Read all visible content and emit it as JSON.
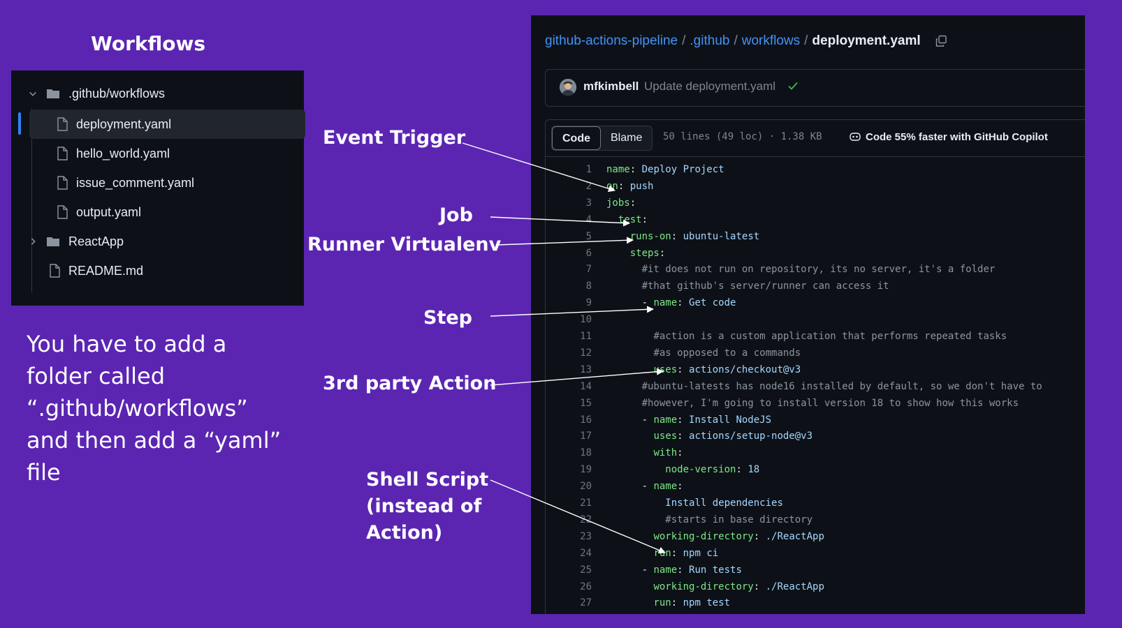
{
  "slide": {
    "title": "Workflows",
    "explanation": "You have to add a folder called “.github/workflows” and then add a “yaml” file"
  },
  "tree": {
    "items": [
      {
        "label": ".github/workflows",
        "kind": "folder",
        "expanded": true
      },
      {
        "label": "deployment.yaml",
        "kind": "file",
        "selected": true
      },
      {
        "label": "hello_world.yaml",
        "kind": "file"
      },
      {
        "label": "issue_comment.yaml",
        "kind": "file"
      },
      {
        "label": "output.yaml",
        "kind": "file"
      },
      {
        "label": "ReactApp",
        "kind": "folder",
        "expanded": false
      },
      {
        "label": "README.md",
        "kind": "file"
      }
    ]
  },
  "annotations": {
    "event_trigger": "Event Trigger",
    "job": "Job",
    "runner": "Runner Virtualenv",
    "step": "Step",
    "third_party": "3rd party Action",
    "shell_l1": "Shell Script",
    "shell_l2": "(instead of",
    "shell_l3": "Action)"
  },
  "viewer": {
    "breadcrumb": {
      "repo": "github-actions-pipeline",
      "sep": "/",
      "dir1": ".github",
      "dir2": "workflows",
      "file": "deployment.yaml"
    },
    "commit": {
      "user": "mfkimbell",
      "message": "Update deployment.yaml"
    },
    "tabs": {
      "code": "Code",
      "blame": "Blame"
    },
    "meta": "50 lines (49 loc) · 1.38 KB",
    "copilot": "Code 55% faster with GitHub Copilot"
  },
  "code_lines": [
    {
      "n": "1",
      "indent": "",
      "key": "name",
      "val": "Deploy Project"
    },
    {
      "n": "2",
      "indent": "",
      "key": "on",
      "val": "push"
    },
    {
      "n": "3",
      "indent": "",
      "key": "jobs",
      "val": ""
    },
    {
      "n": "4",
      "indent": "  ",
      "key": "test",
      "val": ""
    },
    {
      "n": "5",
      "indent": "    ",
      "key": "runs-on",
      "val": "ubuntu-latest"
    },
    {
      "n": "6",
      "indent": "    ",
      "key": "steps",
      "val": ""
    },
    {
      "n": "7",
      "indent": "      ",
      "comment": "#it does not run on repository, its no server, it's a folder"
    },
    {
      "n": "8",
      "indent": "      ",
      "comment": "#that github's server/runner can access it"
    },
    {
      "n": "9",
      "indent": "      ",
      "dash": true,
      "key": "name",
      "val": "Get code"
    },
    {
      "n": "10",
      "indent": "",
      "blank": true
    },
    {
      "n": "11",
      "indent": "        ",
      "comment": "#action is a custom application that performs repeated tasks"
    },
    {
      "n": "12",
      "indent": "        ",
      "comment": "#as opposed to a commands"
    },
    {
      "n": "13",
      "indent": "        ",
      "key": "uses",
      "val": "actions/checkout@v3"
    },
    {
      "n": "14",
      "indent": "      ",
      "comment": "#ubuntu-latests has node16 installed by default, so we don't have to"
    },
    {
      "n": "15",
      "indent": "      ",
      "comment": "#however, I'm going to install version 18 to show how this works"
    },
    {
      "n": "16",
      "indent": "      ",
      "dash": true,
      "key": "name",
      "val": "Install NodeJS"
    },
    {
      "n": "17",
      "indent": "        ",
      "key": "uses",
      "val": "actions/setup-node@v3"
    },
    {
      "n": "18",
      "indent": "        ",
      "key": "with",
      "val": ""
    },
    {
      "n": "19",
      "indent": "          ",
      "key": "node-version",
      "val": "18"
    },
    {
      "n": "20",
      "indent": "      ",
      "dash": true,
      "key": "name",
      "val": ""
    },
    {
      "n": "21",
      "indent": "          ",
      "plain": "Install dependencies"
    },
    {
      "n": "22",
      "indent": "          ",
      "comment": "#starts in base directory"
    },
    {
      "n": "23",
      "indent": "        ",
      "key": "working-directory",
      "val": "./ReactApp"
    },
    {
      "n": "24",
      "indent": "        ",
      "key": "run",
      "val": "npm ci"
    },
    {
      "n": "25",
      "indent": "      ",
      "dash": true,
      "key": "name",
      "val": "Run tests"
    },
    {
      "n": "26",
      "indent": "        ",
      "key": "working-directory",
      "val": "./ReactApp"
    },
    {
      "n": "27",
      "indent": "        ",
      "key": "run",
      "val": "npm test"
    }
  ]
}
